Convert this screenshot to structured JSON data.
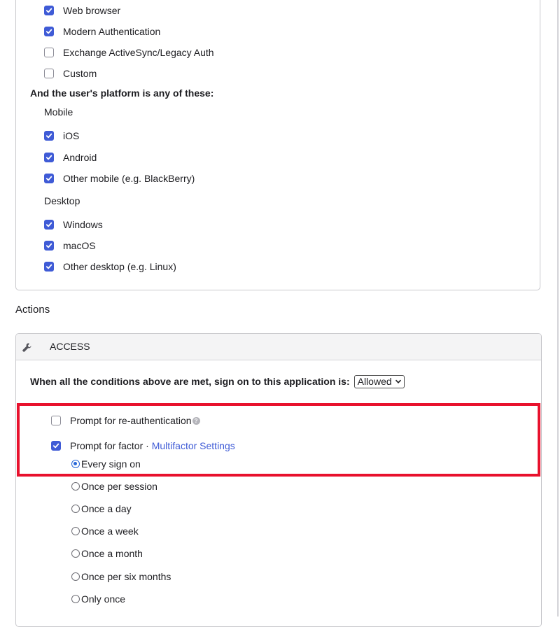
{
  "client_types": [
    {
      "label": "Web browser",
      "checked": true
    },
    {
      "label": "Modern Authentication",
      "checked": true
    },
    {
      "label": "Exchange ActiveSync/Legacy Auth",
      "checked": false
    },
    {
      "label": "Custom",
      "checked": false
    }
  ],
  "platform": {
    "heading": "And the user's platform is any of these:",
    "mobile": {
      "label": "Mobile",
      "items": [
        {
          "label": "iOS",
          "checked": true
        },
        {
          "label": "Android",
          "checked": true
        },
        {
          "label": "Other mobile (e.g. BlackBerry)",
          "checked": true
        }
      ]
    },
    "desktop": {
      "label": "Desktop",
      "items": [
        {
          "label": "Windows",
          "checked": true
        },
        {
          "label": "macOS",
          "checked": true
        },
        {
          "label": "Other desktop (e.g. Linux)",
          "checked": true
        }
      ]
    }
  },
  "actions": {
    "title": "Actions",
    "access_panel": {
      "header_icon": "wrench-icon",
      "header_label": "ACCESS",
      "condition_text": "When all the conditions above are met, sign on to this application is:",
      "select_value": "Allowed",
      "reauth": {
        "label": "Prompt for re-authentication",
        "checked": false,
        "help_icon": "question-mark-icon",
        "help_glyph": "?"
      },
      "factor": {
        "label": "Prompt for factor · ",
        "link_text": "Multifactor Settings",
        "checked": true
      },
      "frequency_options": [
        {
          "label": "Every sign on",
          "selected": true
        },
        {
          "label": "Once per session",
          "selected": false
        },
        {
          "label": "Once a day",
          "selected": false
        },
        {
          "label": "Once a week",
          "selected": false
        },
        {
          "label": "Once a month",
          "selected": false
        },
        {
          "label": "Once per six months",
          "selected": false
        },
        {
          "label": "Only once",
          "selected": false
        }
      ]
    }
  },
  "colors": {
    "checkbox_accent": "#3f5bd6",
    "radio_accent": "#2968d8",
    "highlight": "#e8112d",
    "link": "#3f5bd6"
  }
}
